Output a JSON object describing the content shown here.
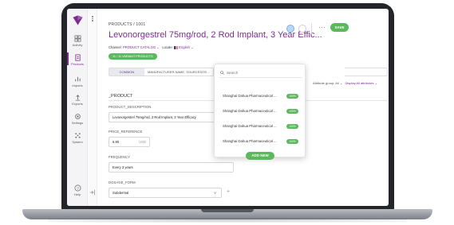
{
  "header": {
    "breadcrumb": "PRODUCTS / 1001",
    "title": "Levonorgestrel 75mg/rod, 2 Rod Implant, 3 Year Effic...",
    "channel_label": "Channel:",
    "channel_value": "PRODUCT CATALOG",
    "locale_label": "Locale:",
    "locale_value": "English",
    "variant_pill": "11 / 11 VARIANT PRODUCTS",
    "more": "···",
    "save_label": "SAVE"
  },
  "nav": {
    "items": [
      {
        "label": "Activity",
        "icon": "activity-icon"
      },
      {
        "label": "Products",
        "icon": "products-icon"
      },
      {
        "label": "Imports",
        "icon": "imports-icon"
      },
      {
        "label": "Exports",
        "icon": "exports-icon"
      },
      {
        "label": "Settings",
        "icon": "settings-icon"
      },
      {
        "label": "System",
        "icon": "system-icon"
      },
      {
        "label": "Help",
        "icon": "help-icon"
      }
    ]
  },
  "tabs": {
    "common": "COMMON",
    "manufacturer": "MANUFACTURER NAME, SOURCESITE..."
  },
  "attributes": {
    "group_label": "Attribute group: All",
    "display_label": "Display All attributes"
  },
  "form": {
    "section": "_PRODUCT",
    "fields": [
      {
        "label": "PRODUCT_DESCRIPTION",
        "value": "Levonorgestrel 75mg/rod, 2 Rod Implant, 3 Year Efficacy"
      },
      {
        "label": "PRICE_REFERENCE",
        "value": "6.90",
        "unit": "USD"
      },
      {
        "label": "FREQUENCY",
        "value": "Every 3 years"
      },
      {
        "label": "DOSAGE_FORM",
        "value": "Subdermal"
      }
    ]
  },
  "popup": {
    "search_placeholder": "Search",
    "rows": [
      {
        "name": "Shanghai Dahua Pharmaceutical ...",
        "pct": "100%"
      },
      {
        "name": "Shanghai Dahua Pharmaceutical ...",
        "pct": "100%"
      },
      {
        "name": "Shanghai Dahua Pharmaceutical ...",
        "pct": "100%"
      },
      {
        "name": "Shanghai Dahua Pharmaceutical ...",
        "pct": "100%"
      }
    ],
    "add_label": "ADD NEW"
  },
  "colors": {
    "brand": "#7b2d8e",
    "success": "#5cb85c"
  }
}
